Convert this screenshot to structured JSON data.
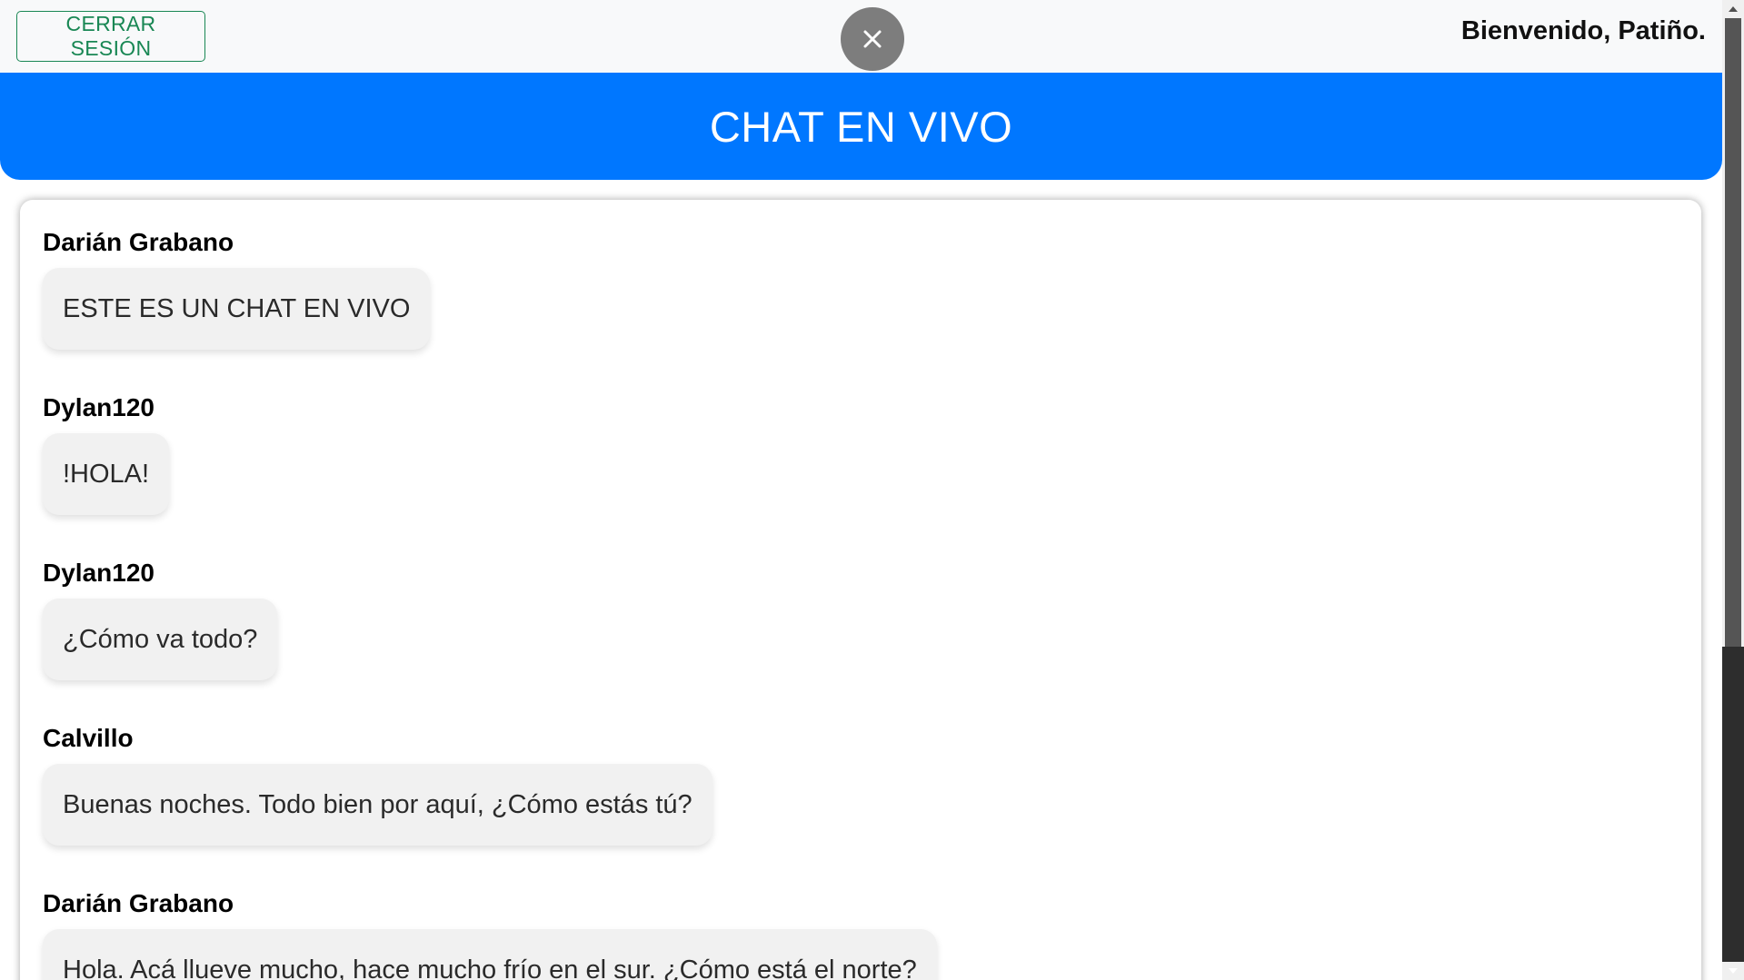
{
  "topbar": {
    "logout_label": "CERRAR SESIÓN",
    "welcome_text": "Bienvenido, Patiño.",
    "close_icon": "close-icon"
  },
  "header": {
    "title": "CHAT EN VIVO"
  },
  "messages": [
    {
      "author": "Darián Grabano",
      "text": "ESTE ES UN CHAT EN VIVO"
    },
    {
      "author": "Dylan120",
      "text": "!HOLA!"
    },
    {
      "author": "Dylan120",
      "text": "¿Cómo va todo?"
    },
    {
      "author": "Calvillo",
      "text": "Buenas noches. Todo bien por aquí, ¿Cómo estás tú?"
    },
    {
      "author": "Darián Grabano",
      "text": "Hola. Acá llueve mucho, hace mucho frío en el sur. ¿Cómo está el norte?"
    }
  ],
  "colors": {
    "header_bg": "#0077ff",
    "logout_accent": "#198754",
    "bubble_bg": "#f1f1f1",
    "close_bg": "#7d7d7d"
  }
}
